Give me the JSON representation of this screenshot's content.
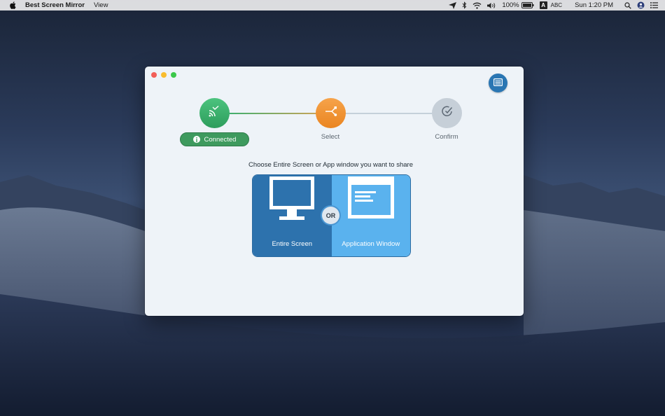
{
  "menubar": {
    "app_name": "Best Screen Mirror",
    "menus": [
      "View"
    ],
    "battery_pct": "100%",
    "input_source": "A",
    "input_label": "ABC",
    "clock": "Sun 1:20 PM"
  },
  "window": {
    "steps": [
      {
        "name": "connect",
        "badge": "Connected",
        "color": "#3e9a5e"
      },
      {
        "name": "select",
        "label": "Select",
        "color": "#f0932f"
      },
      {
        "name": "confirm",
        "label": "Confirm",
        "color": "#c6cfd8"
      }
    ],
    "prompt": "Choose Entire Screen or App window you want to share",
    "options": {
      "entire_screen": "Entire Screen",
      "or": "OR",
      "application_window": "Application Window"
    }
  },
  "icons": {
    "apple": "apple-icon",
    "send": "send-icon",
    "bluetooth": "bluetooth-icon",
    "wifi": "wifi-icon",
    "volume": "volume-icon",
    "battery": "battery-icon",
    "search": "search-icon",
    "siri": "siri-icon",
    "list": "list-icon",
    "cast": "cast-icon",
    "share": "share-icon",
    "check": "check-icon",
    "monitor": "monitor-icon",
    "app_window": "app-window-icon",
    "menu": "menu-icon",
    "info": "info-icon"
  }
}
